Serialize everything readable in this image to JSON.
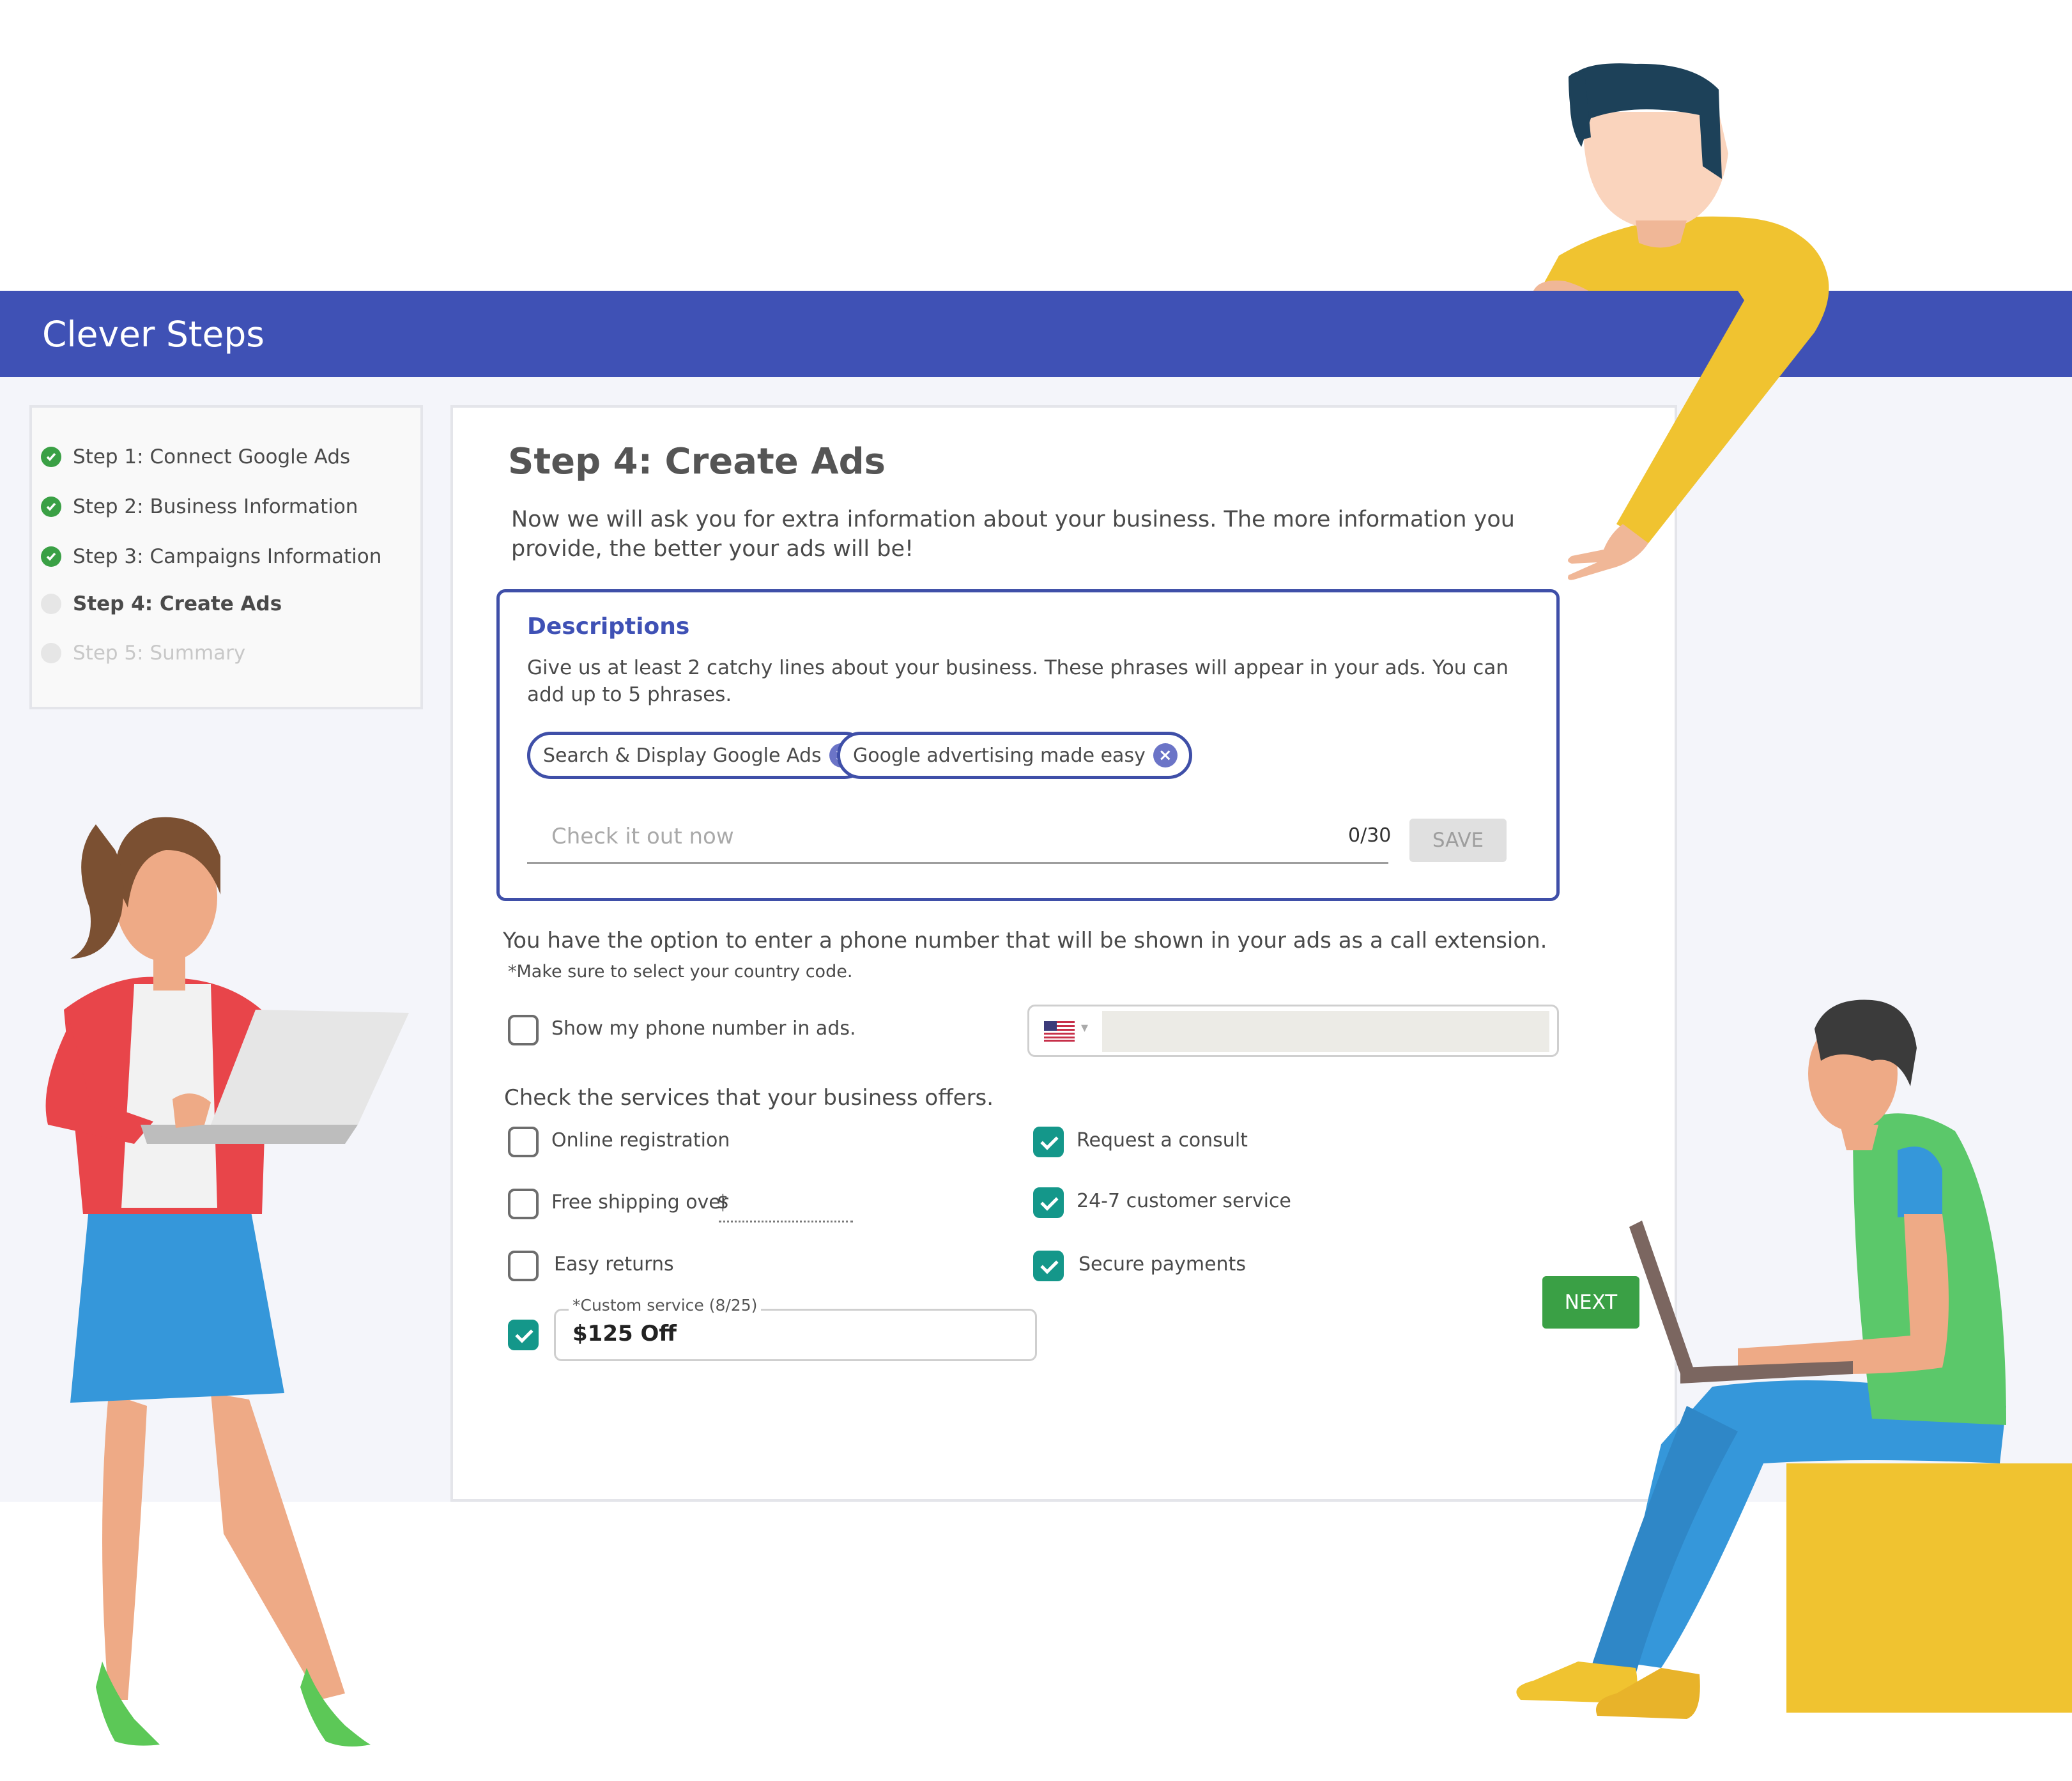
{
  "app": {
    "title": "Clever Steps"
  },
  "steps": [
    {
      "label": "Step 1: Connect Google Ads",
      "status": "complete"
    },
    {
      "label": "Step 2: Business Information",
      "status": "complete"
    },
    {
      "label": "Step 3: Campaigns Information",
      "status": "complete"
    },
    {
      "label": "Step 4: Create Ads",
      "status": "current"
    },
    {
      "label": "Step 5: Summary",
      "status": "upcoming"
    }
  ],
  "main": {
    "title": "Step 4: Create Ads",
    "intro": "Now we will ask you for extra information about your business. The more information you provide, the better your ads will be!"
  },
  "descriptions": {
    "title": "Descriptions",
    "help": "Give us at least 2 catchy lines about your business. These phrases will appear in your ads. You can add up to 5 phrases.",
    "chips": [
      "Search & Display Google Ads",
      "Google advertising made easy"
    ],
    "input_placeholder": "Check it out now",
    "counter": "0/30",
    "save_label": "SAVE"
  },
  "phone": {
    "text": "You have the option to enter a phone number that will be shown in your ads as a call extension.",
    "note": "*Make sure to select your country code.",
    "checkbox_label": "Show my phone number in ads.",
    "checked": false,
    "country_flag": "us-flag-icon"
  },
  "services": {
    "title": "Check the services that your business offers.",
    "left": [
      {
        "label": "Online registration",
        "checked": false
      },
      {
        "label": "Free shipping over",
        "suffix": "$",
        "checked": false
      },
      {
        "label": "Easy returns",
        "checked": false
      }
    ],
    "right": [
      {
        "label": "Request a consult",
        "checked": true
      },
      {
        "label": "24-7 customer service",
        "checked": true
      },
      {
        "label": "Secure payments",
        "checked": true
      }
    ],
    "custom": {
      "label": "*Custom service (8/25)",
      "value": "$125 Off",
      "checked": true
    }
  },
  "next_label": "NEXT",
  "colors": {
    "header": "#3f51b5",
    "accent_blue": "#3f4fa8",
    "success_green": "#3aa045",
    "checkbox_teal": "#14978a"
  }
}
